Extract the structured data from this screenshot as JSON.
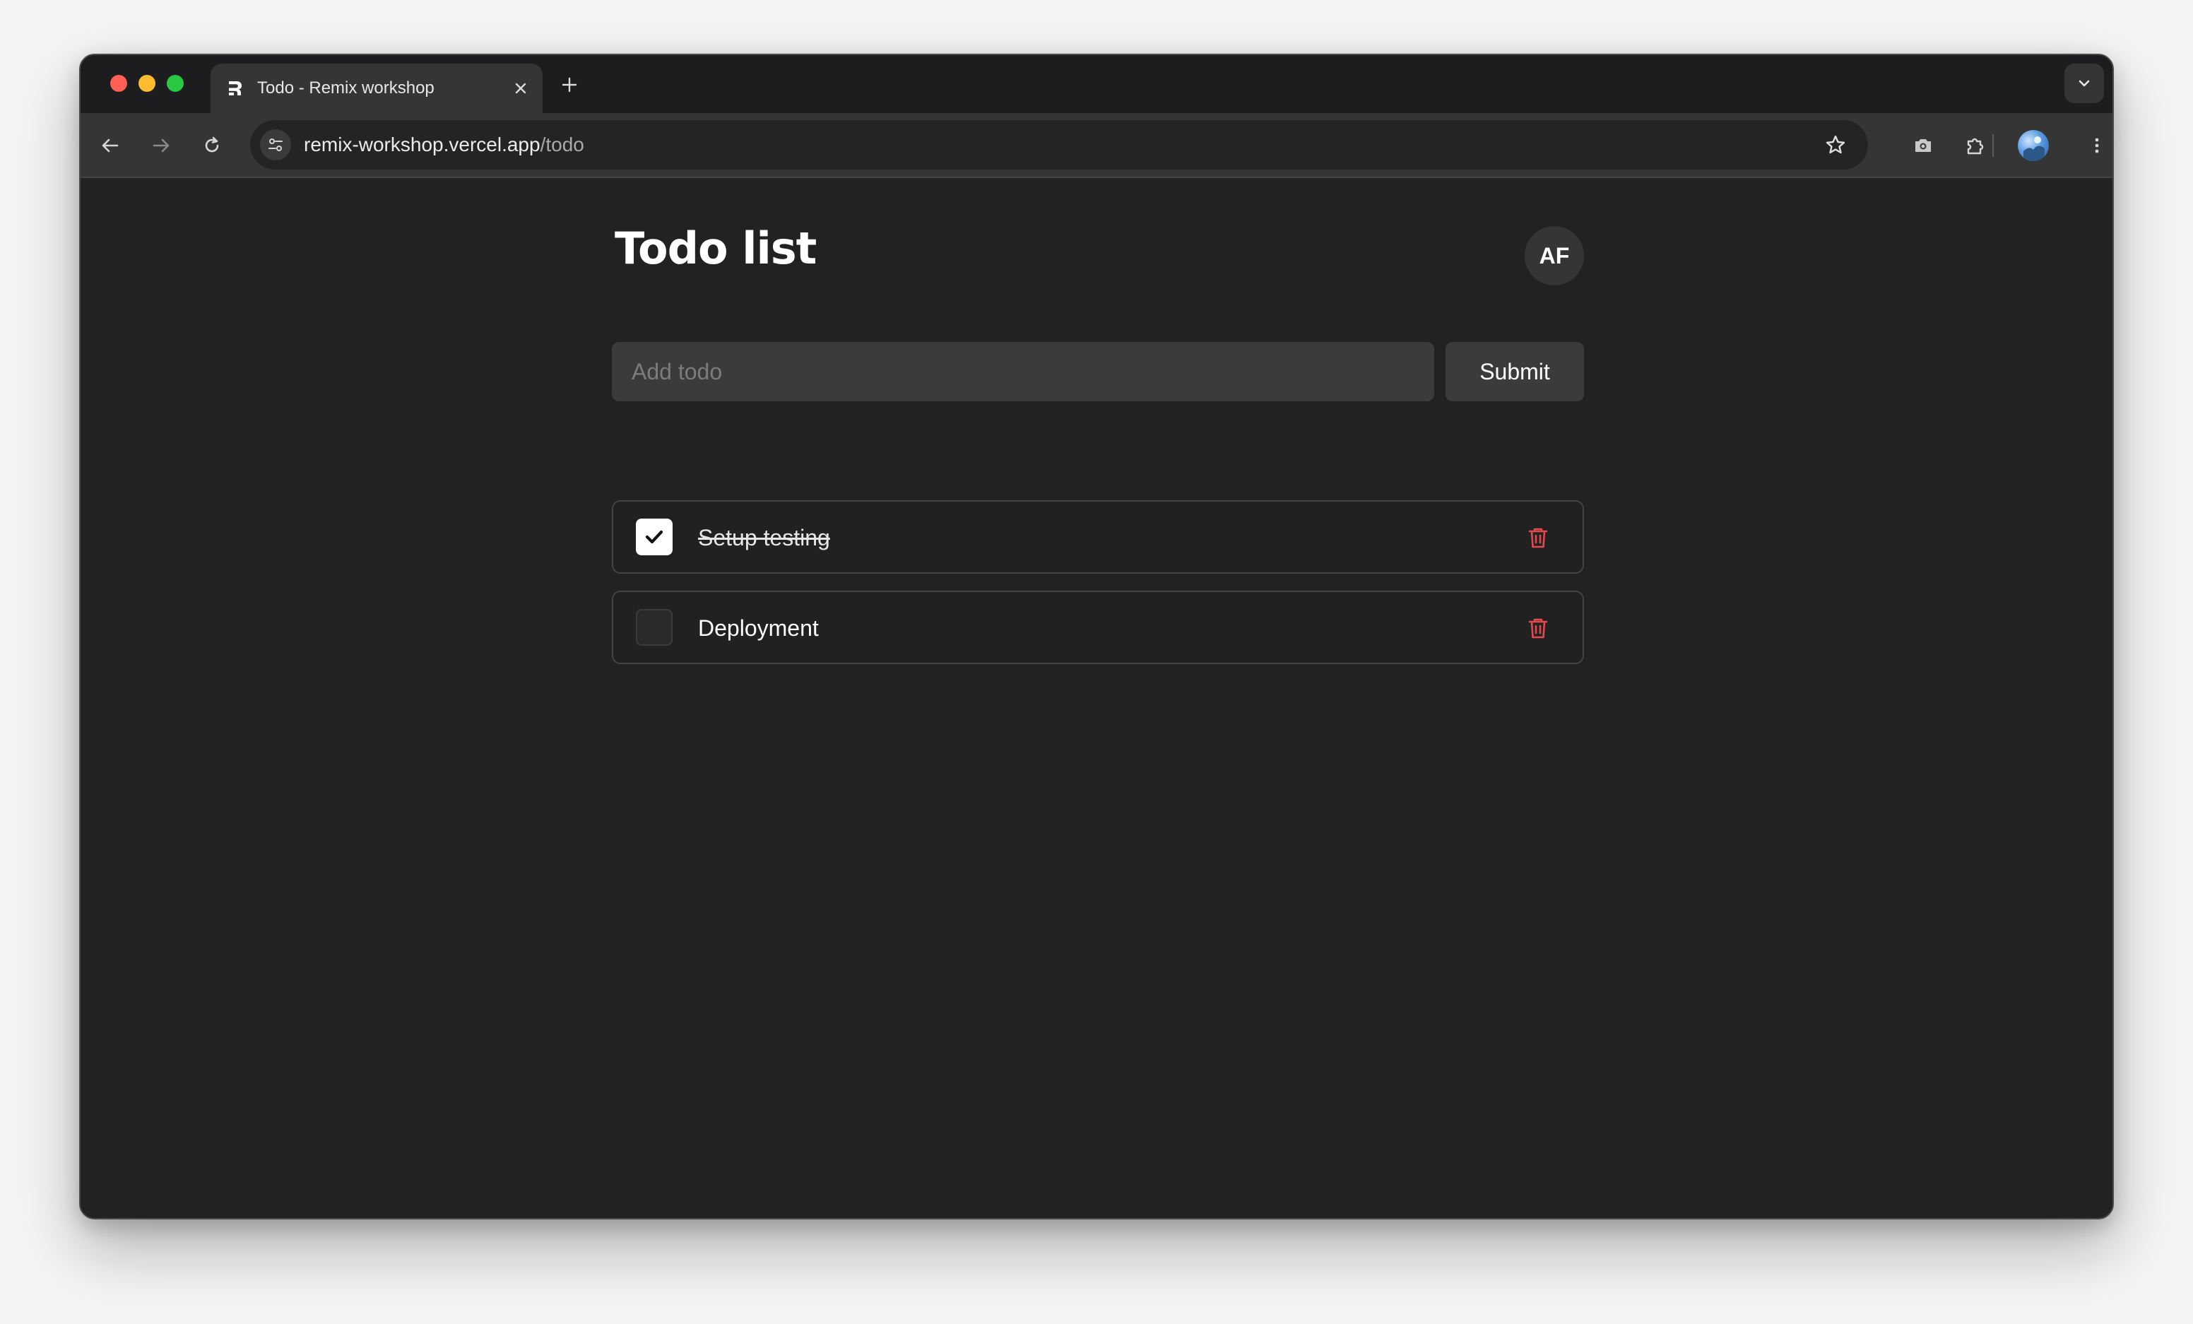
{
  "browser": {
    "tab_title": "Todo - Remix workshop",
    "url_host": "remix-workshop.vercel.app",
    "url_path": "/todo"
  },
  "page": {
    "title": "Todo list",
    "user_initials": "AF",
    "input_placeholder": "Add todo",
    "input_value": "",
    "submit_label": "Submit"
  },
  "todos": [
    {
      "label": "Setup testing",
      "completed": true
    },
    {
      "label": "Deployment",
      "completed": false
    }
  ],
  "colors": {
    "background": "#222222",
    "input_background": "#3b3b3b",
    "delete_icon": "#e5484d",
    "text": "#ffffff"
  },
  "icons": {
    "tab_favicon": "remix-logo-icon",
    "tab_close": "close-icon",
    "new_tab": "plus-icon",
    "tab_search": "chevron-down-icon",
    "back": "arrow-left-icon",
    "forward": "arrow-right-icon",
    "reload": "reload-icon",
    "site_info": "tune-icon",
    "bookmark": "star-icon",
    "screenshot": "camera-icon",
    "extensions": "puzzle-icon",
    "profile": "profile-avatar-icon",
    "menu": "kebab-menu-icon",
    "check": "check-icon",
    "delete": "trash-icon"
  }
}
